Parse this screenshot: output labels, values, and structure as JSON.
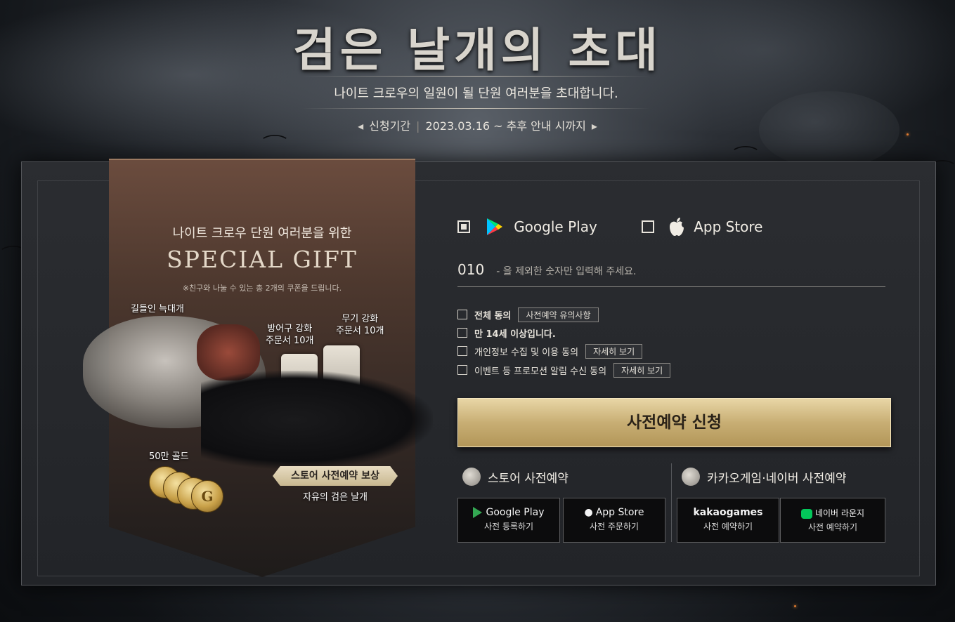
{
  "header": {
    "title": "검은 날개의 초대",
    "subtitle": "나이트 크로우의 일원이 될 단원 여러분을 초대합니다.",
    "period_label": "신청기간",
    "period_value": "2023.03.16 ~ 추후 안내 시까지"
  },
  "gift": {
    "heading": "나이트 크로우 단원 여러분을 위한",
    "big_title": "SPECIAL GIFT",
    "note": "※친구와 나눌 수 있는 총 2개의 쿠폰을 드립니다.",
    "items": {
      "wolf": "길들인 늑대개",
      "armor_scroll": "방어구 강화\n주문서 10개",
      "weapon_scroll": "무기 강화\n주문서 10개",
      "gold": "50만 골드",
      "store_badge": "스토어 사전예약 보상",
      "wing": "자유의 검은 날개",
      "coin_glyph": "G"
    }
  },
  "form": {
    "platforms": [
      {
        "label": "Google Play",
        "checked": true
      },
      {
        "label": "App Store",
        "checked": false
      }
    ],
    "phone_prefix": "010",
    "phone_placeholder": "- 을 제외한 숫자만 입력해 주세요.",
    "agreements": [
      {
        "label": "전체 동의",
        "button": "사전예약 유의사항"
      },
      {
        "label": "만 14세 이상입니다.",
        "button": ""
      },
      {
        "label": "개인정보 수집 및 이용 동의",
        "button": "자세히 보기"
      },
      {
        "label": "이벤트 등 프로모션 알림 수신 동의",
        "button": "자세히 보기"
      }
    ],
    "submit_label": "사전예약 신청"
  },
  "preregister": {
    "store_title": "스토어 사전예약",
    "partner_title": "카카오게임·네이버 사전예약",
    "buttons": [
      {
        "brand": "Google Play",
        "action": "사전 등록하기"
      },
      {
        "brand": "App Store",
        "action": "사전 주문하기"
      },
      {
        "brand": "kakaogames",
        "action": "사전 예약하기"
      },
      {
        "brand": "네이버 라운지",
        "action": "사전 예약하기"
      }
    ]
  },
  "colors": {
    "accent_gold": "#c8ae74",
    "google_green": "#34a853",
    "naver_green": "#03c75a"
  },
  "icons": [
    "google-play-icon",
    "apple-icon",
    "crow-logo-icon",
    "naver-icon"
  ]
}
